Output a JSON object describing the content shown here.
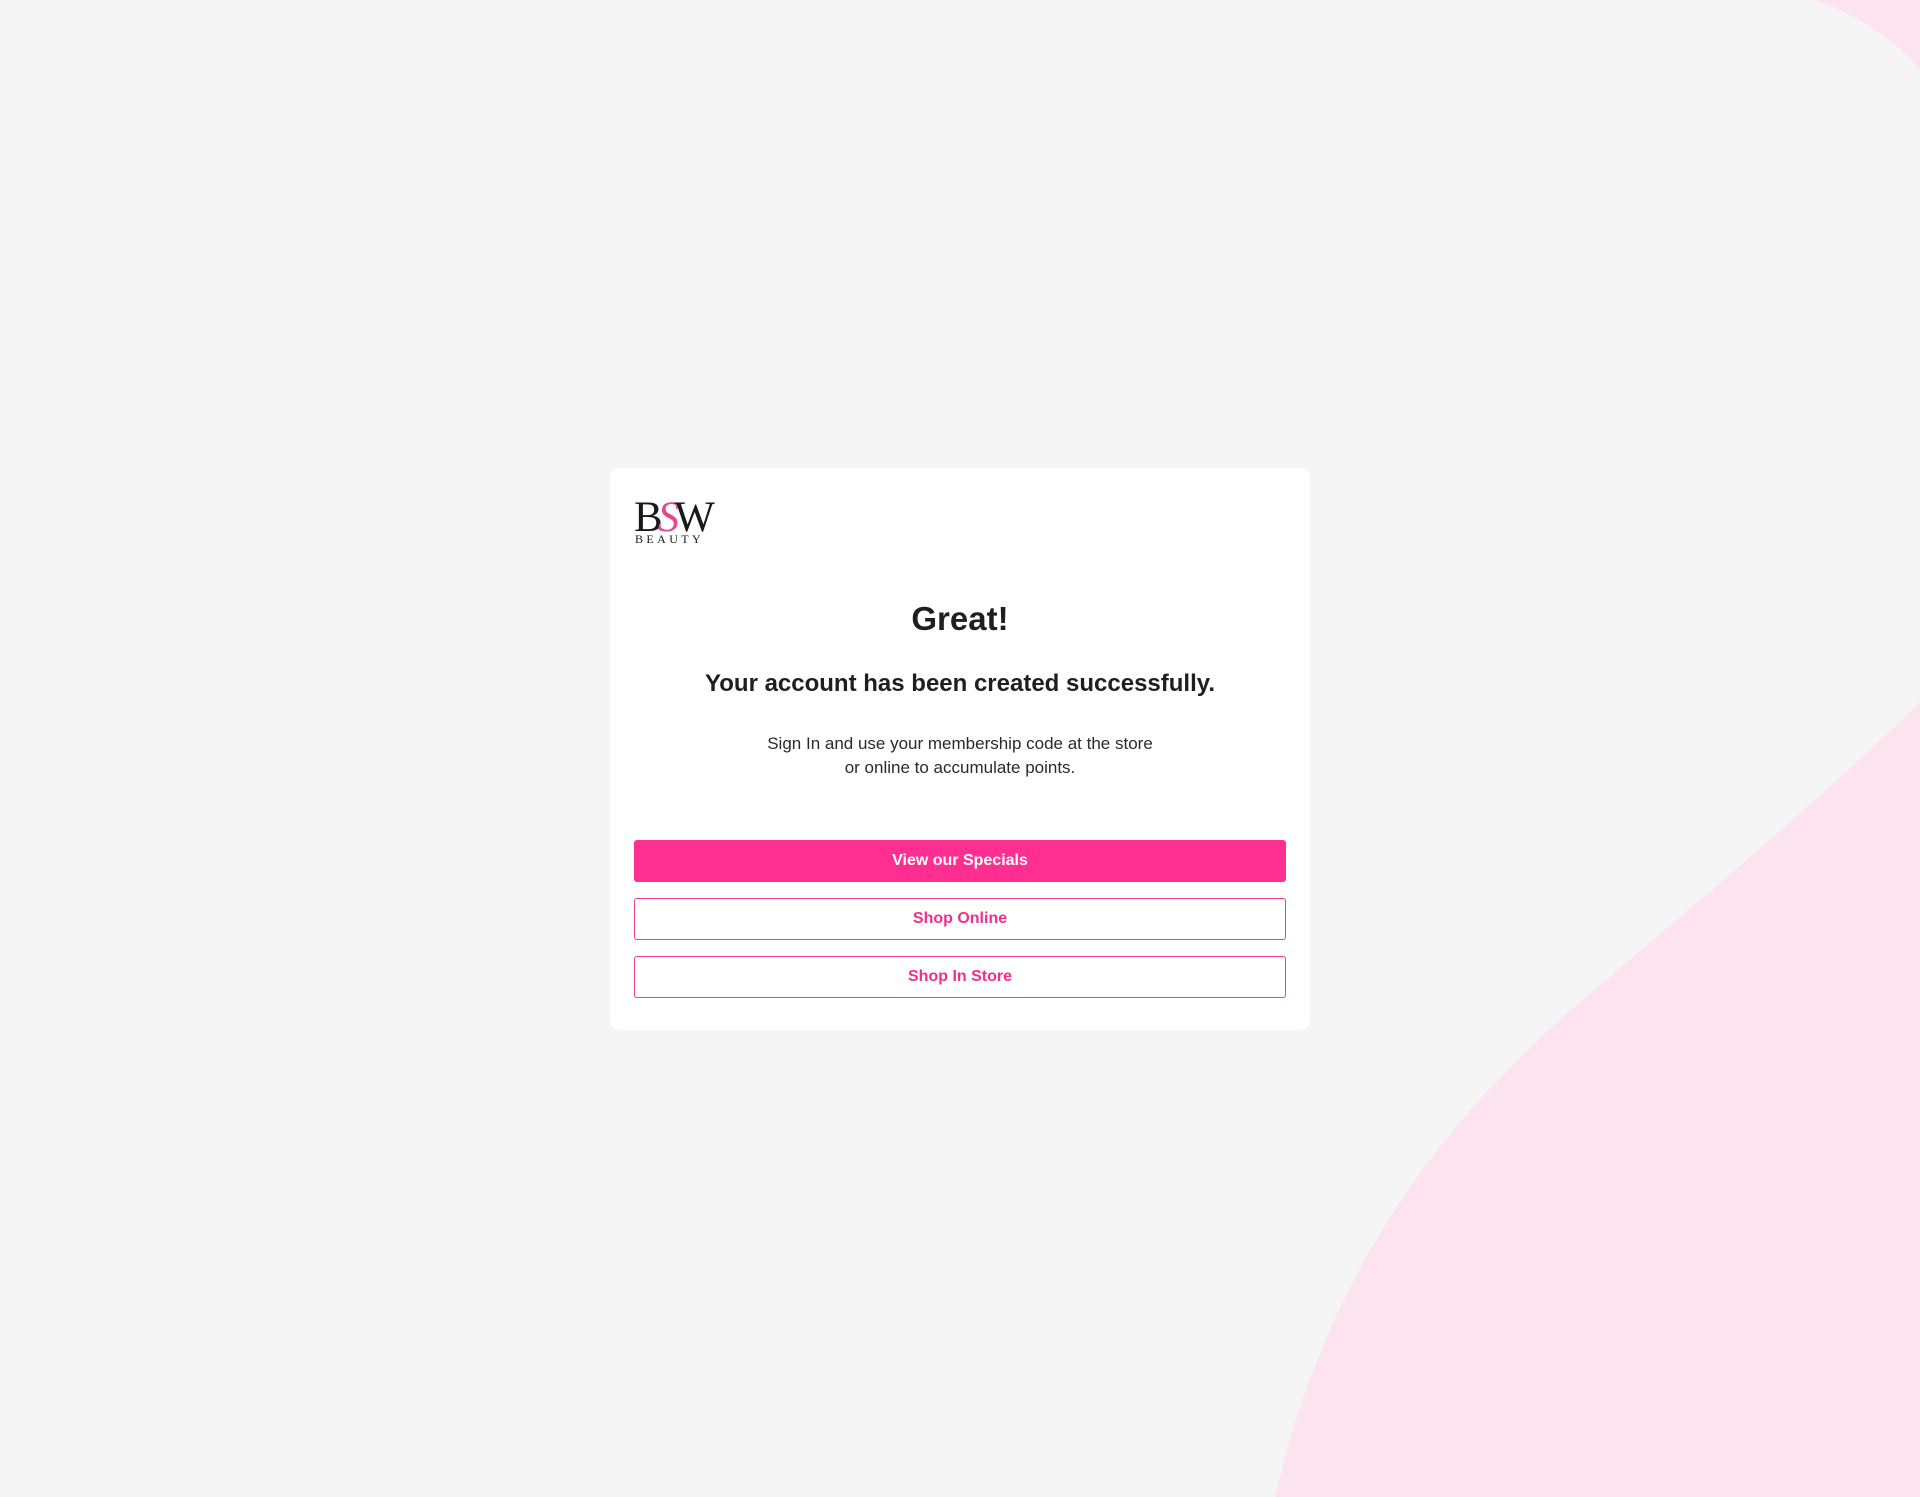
{
  "colors": {
    "background": "#f5f5f5",
    "wave": "#fde3ef",
    "accent": "#ff2f92",
    "card": "#ffffff",
    "text": "#1f1f1f"
  },
  "logo": {
    "letter_b": "B",
    "letter_s": "S",
    "letter_w": "W",
    "tagline": "BEAUTY"
  },
  "message": {
    "title": "Great!",
    "subtitle": "Your account has been created successfully.",
    "description_line1": "Sign In and use your membership code at the store",
    "description_line2": "or online to accumulate points."
  },
  "actions": {
    "specials_label": "View our Specials",
    "shop_online_label": "Shop Online",
    "shop_in_store_label": "Shop In Store"
  }
}
